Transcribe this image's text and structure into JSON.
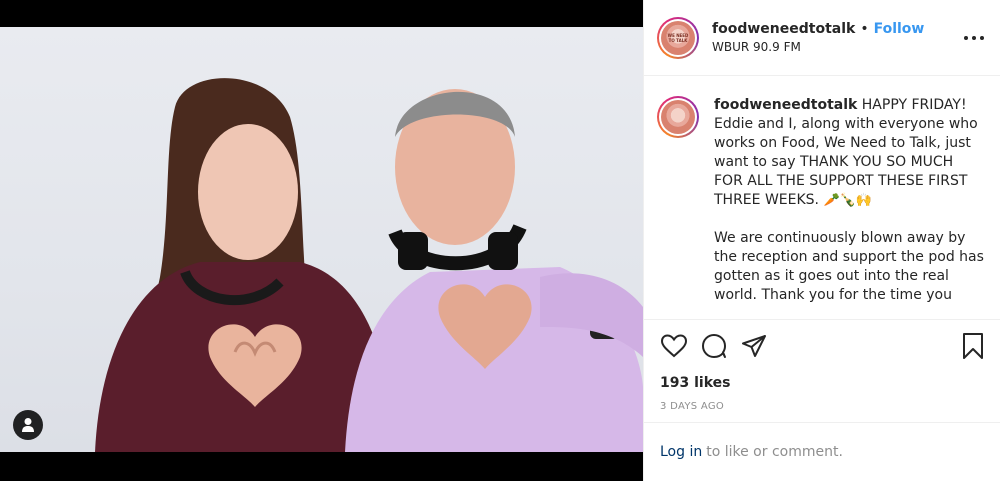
{
  "post": {
    "account": {
      "username": "foodweneedtotalk",
      "follow_label": "Follow",
      "separator": "•",
      "location": "WBUR 90.9 FM",
      "avatar_text": "WE NEED TO TALK"
    },
    "caption": {
      "username": "foodweneedtotalk",
      "paragraph1": "HAPPY FRIDAY! Eddie and I, along with everyone who works on Food, We Need to Talk, just want to say THANK YOU SO MUCH FOR ALL THE SUPPORT THESE FIRST THREE WEEKS.",
      "emojis": "🥕🍾🙌",
      "paragraph2": "We are continuously blown away by the reception and support the pod has gotten as it goes out into the real world. Thank you for the time you"
    },
    "likes": "193 likes",
    "timestamp": "3 DAYS AGO",
    "comment_bar": {
      "login_label": "Log in",
      "rest_text": "to like or comment."
    }
  },
  "icons": {
    "more": "more-options-icon",
    "like": "heart-icon",
    "comment": "comment-icon",
    "share": "share-icon",
    "save": "bookmark-icon",
    "tags": "user-tag-icon"
  },
  "colors": {
    "link_blue": "#3897f0",
    "login_blue": "#003569",
    "muted_gray": "#8e8e8e",
    "text": "#262626",
    "border": "#efefef"
  }
}
